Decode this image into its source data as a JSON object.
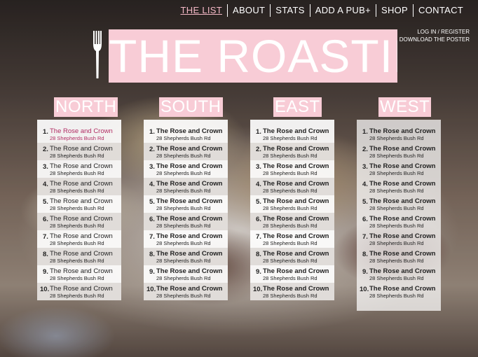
{
  "nav": {
    "items": [
      "THE LIST",
      "ABOUT",
      "STATS",
      "ADD A PUB+",
      "SHOP",
      "CONTACT"
    ]
  },
  "account": {
    "login": "LOG IN / REGISTER",
    "poster": "DOWNLOAD THE POSTER"
  },
  "logo": {
    "text": "THE ROASTIE$"
  },
  "regions": [
    {
      "title": "NORTH",
      "items": [
        {
          "rank": "1.",
          "name": "The Rose and Crown",
          "address": "28 Shepherds Bush Rd"
        },
        {
          "rank": "2.",
          "name": "The Rose and Crown",
          "address": "28 Shepherds Bush Rd"
        },
        {
          "rank": "3.",
          "name": "The Rose and Crown",
          "address": "28 Shepherds Bush Rd"
        },
        {
          "rank": "4.",
          "name": "The Rose and Crown",
          "address": "28 Shepherds Bush Rd"
        },
        {
          "rank": "5.",
          "name": "The Rose and Crown",
          "address": "28 Shepherds Bush Rd"
        },
        {
          "rank": "6.",
          "name": "The Rose and Crown",
          "address": "28 Shepherds Bush Rd"
        },
        {
          "rank": "7.",
          "name": "The Rose and Crown",
          "address": "28 Shepherds Bush Rd"
        },
        {
          "rank": "8.",
          "name": "The Rose and Crown",
          "address": "28 Shepherds Bush Rd"
        },
        {
          "rank": "9.",
          "name": "The Rose and Crown",
          "address": "28 Shepherds Bush Rd"
        },
        {
          "rank": "10.",
          "name": "The Rose and Crown",
          "address": "28 Shepherds Bush Rd"
        }
      ]
    },
    {
      "title": "SOUTH",
      "items": [
        {
          "rank": "1.",
          "name": "The Rose and Crown",
          "address": "28 Shepherds Bush Rd"
        },
        {
          "rank": "2.",
          "name": "The Rose and Crown",
          "address": "28 Shepherds Bush Rd"
        },
        {
          "rank": "3.",
          "name": "The Rose and Crown",
          "address": "28 Shepherds Bush Rd"
        },
        {
          "rank": "4.",
          "name": "The Rose and Crown",
          "address": "28 Shepherds Bush Rd"
        },
        {
          "rank": "5.",
          "name": "The Rose and Crown",
          "address": "28 Shepherds Bush Rd"
        },
        {
          "rank": "6.",
          "name": "The Rose and Crown",
          "address": "28 Shepherds Bush Rd"
        },
        {
          "rank": "7.",
          "name": "The Rose and Crown",
          "address": "28 Shepherds Bush Rd"
        },
        {
          "rank": "8.",
          "name": "The Rose and Crown",
          "address": "28 Shepherds Bush Rd"
        },
        {
          "rank": "9.",
          "name": "The Rose and Crown",
          "address": "28 Shepherds Bush Rd"
        },
        {
          "rank": "10.",
          "name": "The Rose and Crown",
          "address": "28 Shepherds Bush Rd"
        }
      ]
    },
    {
      "title": "EAST",
      "items": [
        {
          "rank": "1.",
          "name": "The Rose and Crown",
          "address": "28 Shepherds Bush Rd"
        },
        {
          "rank": "2.",
          "name": "The Rose and Crown",
          "address": "28 Shepherds Bush Rd"
        },
        {
          "rank": "3.",
          "name": "The Rose and Crown",
          "address": "28 Shepherds Bush Rd"
        },
        {
          "rank": "4.",
          "name": "The Rose and Crown",
          "address": "28 Shepherds Bush Rd"
        },
        {
          "rank": "5.",
          "name": "The Rose and Crown",
          "address": "28 Shepherds Bush Rd"
        },
        {
          "rank": "6.",
          "name": "The Rose and Crown",
          "address": "28 Shepherds Bush Rd"
        },
        {
          "rank": "7.",
          "name": "The Rose and Crown",
          "address": "28 Shepherds Bush Rd"
        },
        {
          "rank": "8.",
          "name": "The Rose and Crown",
          "address": "28 Shepherds Bush Rd"
        },
        {
          "rank": "9.",
          "name": "The Rose and Crown",
          "address": "28 Shepherds Bush Rd"
        },
        {
          "rank": "10.",
          "name": "The Rose and Crown",
          "address": "28 Shepherds Bush Rd"
        }
      ]
    },
    {
      "title": "WEST",
      "items": [
        {
          "rank": "1.",
          "name": "The Rose and Crown",
          "address": "28 Shepherds Bush Rd"
        },
        {
          "rank": "2.",
          "name": "The Rose and Crown",
          "address": "28 Shepherds Bush Rd"
        },
        {
          "rank": "3.",
          "name": "The Rose and Crown",
          "address": "28 Shepherds Bush Rd"
        },
        {
          "rank": "4.",
          "name": "The Rose and Crown",
          "address": "28 Shepherds Bush Rd"
        },
        {
          "rank": "5.",
          "name": "The Rose and Crown",
          "address": "28 Shepherds Bush Rd"
        },
        {
          "rank": "6.",
          "name": "The Rose and Crown",
          "address": "28 Shepherds Bush Rd"
        },
        {
          "rank": "7.",
          "name": "The Rose and Crown",
          "address": "28 Shepherds Bush Rd"
        },
        {
          "rank": "8.",
          "name": "The Rose and Crown",
          "address": "28 Shepherds Bush Rd"
        },
        {
          "rank": "9.",
          "name": "The Rose and Crown",
          "address": "28 Shepherds Bush Rd"
        },
        {
          "rank": "10.",
          "name": "The Rose and Crown",
          "address": "28 Shepherds Bush Rd"
        }
      ]
    }
  ],
  "colors": {
    "brand_pink": "#f8ccd6",
    "active_link": "#f4b8c6",
    "highlight_text": "#b12d63"
  }
}
